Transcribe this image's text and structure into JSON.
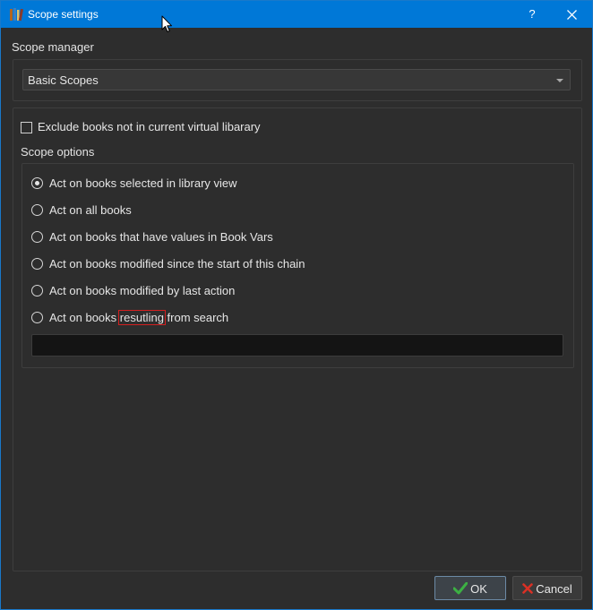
{
  "window": {
    "title": "Scope settings",
    "help_label": "?",
    "close_label": "✕",
    "app_icon": "books-icon"
  },
  "scope_manager": {
    "label": "Scope manager",
    "selected": "Basic Scopes"
  },
  "exclude_checkbox": {
    "label": "Exclude books not in current virtual libarary",
    "checked": false
  },
  "scope_options": {
    "label": "Scope options",
    "options": [
      {
        "label": "Act on books selected in library view",
        "checked": true
      },
      {
        "label": "Act on all books",
        "checked": false
      },
      {
        "label": "Act on books that have values in Book Vars",
        "checked": false
      },
      {
        "label": "Act on books modified since the start of this chain",
        "checked": false
      },
      {
        "label": "Act on books modified by last action",
        "checked": false
      },
      {
        "label_before": "Act on books ",
        "label_highlight": "resutling",
        "label_after": " from search",
        "checked": false
      }
    ],
    "search_value": ""
  },
  "buttons": {
    "ok_label": "OK",
    "cancel_label": "Cancel"
  },
  "colors": {
    "titlebar": "#0078d7",
    "background": "#2d2d2d",
    "highlight_border": "#d42020",
    "ok_icon": "#3cb043",
    "cancel_icon": "#d93025"
  }
}
